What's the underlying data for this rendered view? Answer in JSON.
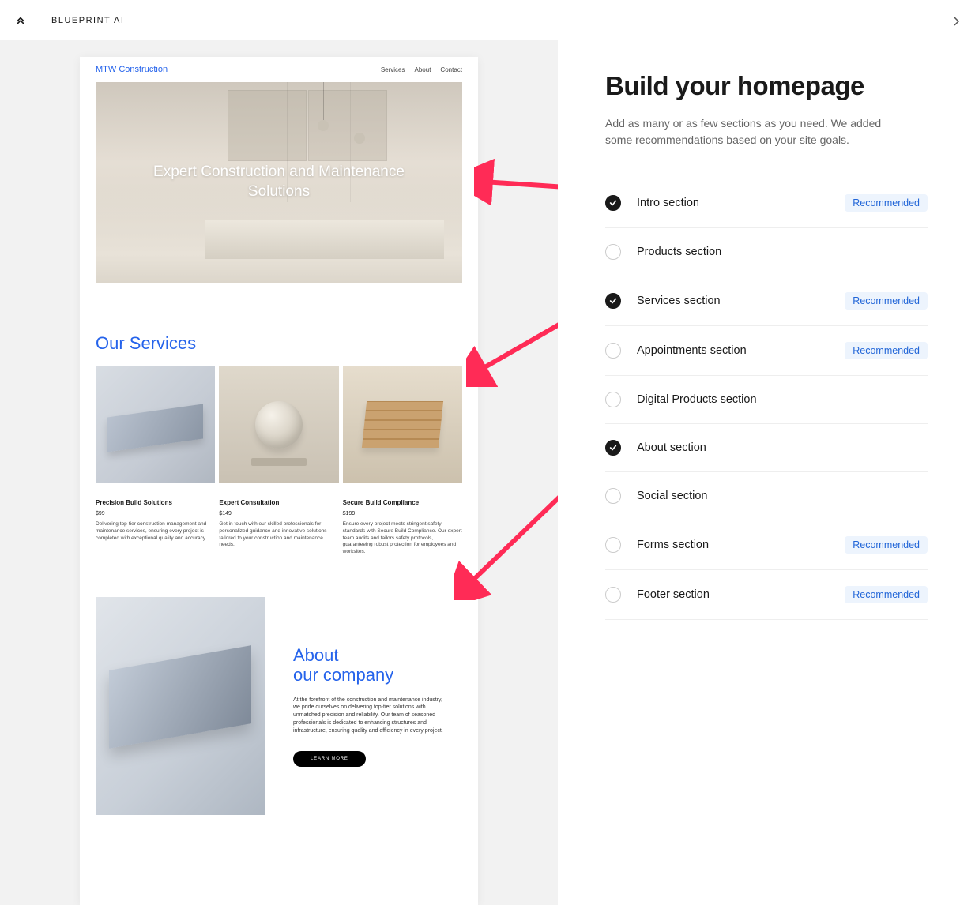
{
  "header": {
    "brand": "BLUEPRINT AI"
  },
  "preview": {
    "site_brand": "MTW Construction",
    "nav": [
      "Services",
      "About",
      "Contact"
    ],
    "hero_title": "Expert Construction and Maintenance Solutions",
    "services_heading": "Our Services",
    "services": [
      {
        "title": "Precision Build Solutions",
        "price": "$99",
        "desc": "Delivering top-tier construction management and maintenance services, ensuring every project is completed with exceptional quality and accuracy."
      },
      {
        "title": "Expert Consultation",
        "price": "$149",
        "desc": "Get in touch with our skilled professionals for personalized guidance and innovative solutions tailored to your construction and maintenance needs."
      },
      {
        "title": "Secure Build Compliance",
        "price": "$199",
        "desc": "Ensure every project meets stringent safety standards with Secure Build Compliance. Our expert team audits and tailors safety protocols, guaranteeing robust protection for employees and worksites."
      }
    ],
    "about_heading_line1": "About",
    "about_heading_line2": "our company",
    "about_text": "At the forefront of the construction and maintenance industry, we pride ourselves on delivering top-tier solutions with unmatched precision and reliability. Our team of seasoned professionals is dedicated to enhancing structures and infrastructure, ensuring quality and efficiency in every project.",
    "learn_more": "LEARN MORE"
  },
  "panel": {
    "title": "Build your homepage",
    "subtitle": "Add as many or as few sections as you need. We added some recommendations based on your site goals.",
    "recommended_label": "Recommended",
    "sections": [
      {
        "label": "Intro section",
        "checked": true,
        "recommended": true
      },
      {
        "label": "Products section",
        "checked": false,
        "recommended": false
      },
      {
        "label": "Services section",
        "checked": true,
        "recommended": true
      },
      {
        "label": "Appointments section",
        "checked": false,
        "recommended": true
      },
      {
        "label": "Digital Products section",
        "checked": false,
        "recommended": false
      },
      {
        "label": "About section",
        "checked": true,
        "recommended": false
      },
      {
        "label": "Social section",
        "checked": false,
        "recommended": false
      },
      {
        "label": "Forms section",
        "checked": false,
        "recommended": true
      },
      {
        "label": "Footer section",
        "checked": false,
        "recommended": true
      }
    ]
  }
}
